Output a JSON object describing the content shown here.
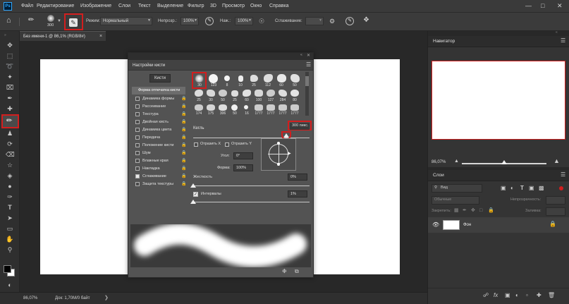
{
  "menu": {
    "items": [
      "Файл",
      "Редактирование",
      "Изображение",
      "Слои",
      "Текст",
      "Выделение",
      "Фильтр",
      "3D",
      "Просмотр",
      "Окно",
      "Справка"
    ],
    "logo": "Ps"
  },
  "options": {
    "brush_size": "300",
    "mode_label": "Режим:",
    "mode_value": "Нормальный",
    "opacity_label": "Непрозр.:",
    "opacity_value": "100%",
    "flow_label": "Наж.:",
    "flow_value": "100%",
    "smoothing_label": "Сглаживание:"
  },
  "document": {
    "tab_title": "Без имени-1 @ 86,1% (RGB/8#)",
    "close": "×"
  },
  "status": {
    "zoom": "86,07%",
    "doc_size": "Док: 1,70M/0 байт"
  },
  "brush_settings": {
    "title": "Настройки кисти",
    "brushes_button": "Кисти",
    "sidebar": [
      {
        "label": "Форма отпечатка кисти",
        "checkbox": false,
        "checked": false,
        "active": true
      },
      {
        "label": "Динамика формы",
        "checkbox": true,
        "checked": false
      },
      {
        "label": "Рассеивание",
        "checkbox": true,
        "checked": false
      },
      {
        "label": "Текстура",
        "checkbox": true,
        "checked": false
      },
      {
        "label": "Двойная кисть",
        "checkbox": true,
        "checked": false
      },
      {
        "label": "Динамика цвета",
        "checkbox": true,
        "checked": false
      },
      {
        "label": "Передача",
        "checkbox": true,
        "checked": false
      },
      {
        "label": "Положение кисти",
        "checkbox": true,
        "checked": false
      },
      {
        "label": "Шум",
        "checkbox": true,
        "checked": false
      },
      {
        "label": "Влажные края",
        "checkbox": true,
        "checked": false
      },
      {
        "label": "Накладка",
        "checkbox": true,
        "checked": false
      },
      {
        "label": "Сглаживание",
        "checkbox": true,
        "checked": true
      },
      {
        "label": "Защита текстуры",
        "checkbox": true,
        "checked": false
      }
    ],
    "presets_row1": [
      "30",
      "123",
      "8",
      "10",
      "25",
      "112",
      "60",
      "50"
    ],
    "presets_row2": [
      "25",
      "30",
      "50",
      "25",
      "60",
      "100",
      "127",
      "284",
      "80"
    ],
    "presets_row3": [
      "174",
      "175",
      "306",
      "50",
      "16",
      "1777",
      "1777",
      "1777",
      "1777"
    ],
    "size_label": "Кегль",
    "size_value": "300 пикс.",
    "flip_x": "Отразить X",
    "flip_y": "Отразить Y",
    "angle_label": "Угол:",
    "angle_value": "0°",
    "roundness_label": "Форма:",
    "roundness_value": "100%",
    "hardness_label": "Жесткость",
    "hardness_value": "0%",
    "spacing_label": "Интервалы",
    "spacing_value": "1%"
  },
  "navigator": {
    "title": "Навигатор",
    "zoom": "86,07%"
  },
  "layers": {
    "title": "Слои",
    "search_placeholder": "Вид",
    "blend_mode": "Обычные",
    "opacity_label": "Непрозрачность:",
    "lock_label": "Закрепить:",
    "fill_label": "Заливка:",
    "layer_name": "Фон"
  }
}
